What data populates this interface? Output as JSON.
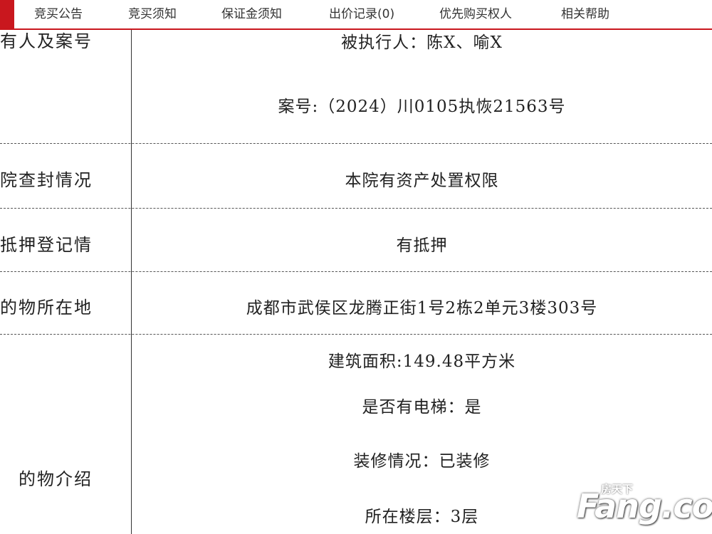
{
  "tabs": [
    {
      "label": "竞买公告"
    },
    {
      "label": "竞买须知"
    },
    {
      "label": "保证金须知"
    },
    {
      "label": "出价记录(0)"
    },
    {
      "label": "优先购买权人"
    },
    {
      "label": "相关帮助"
    }
  ],
  "rows": [
    {
      "label": "所有人及案号",
      "values": [
        "被执行人：陈X、喻X",
        "案号:（2024）川0105执恢21563号"
      ]
    },
    {
      "label": "院查封情况",
      "values": [
        "本院有资产处置权限"
      ]
    },
    {
      "label": "抵押登记情",
      "values": [
        "有抵押"
      ]
    },
    {
      "label": "的物所在地",
      "values": [
        "成都市武侯区龙腾正街1号2栋2单元3楼303号"
      ]
    },
    {
      "label": "的物介绍",
      "values": [
        "建筑面积:149.48平方米",
        "是否有电梯：是",
        "装修情况：已装修",
        "所在楼层：3层"
      ]
    }
  ],
  "watermark": {
    "brand": "Fang.com",
    "cn": "房天下"
  },
  "colors": {
    "accent": "#c9171e",
    "text": "#222222"
  }
}
